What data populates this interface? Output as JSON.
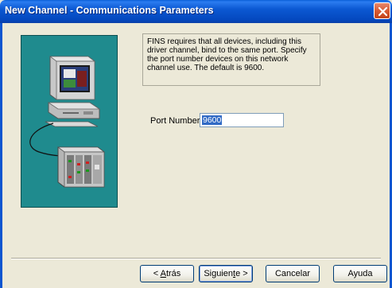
{
  "window": {
    "title": "New Channel - Communications Parameters"
  },
  "info": {
    "lines": [
      "FINS requires that all devices, including this",
      "driver channel, bind to the same port.  Specify",
      "the port number devices on this network",
      "channel use.  The default is 9600."
    ]
  },
  "port": {
    "label": "Port Number",
    "value": "9600"
  },
  "buttons": {
    "back_prefix": "< ",
    "back_mnemonic": "A",
    "back_rest": "trás",
    "next_prefix": "Siguien",
    "next_mnemonic": "t",
    "next_rest": "e >",
    "cancel": "Cancelar",
    "help": "Ayuda"
  },
  "colors": {
    "titlebar": "#0b58d2",
    "illustration_bg": "#1f8b8e",
    "selection": "#316ac5",
    "dialog_bg": "#ece9d8"
  },
  "icons": {
    "close": "close-icon",
    "computer": "computer-icon",
    "plc": "plc-device-icon"
  }
}
